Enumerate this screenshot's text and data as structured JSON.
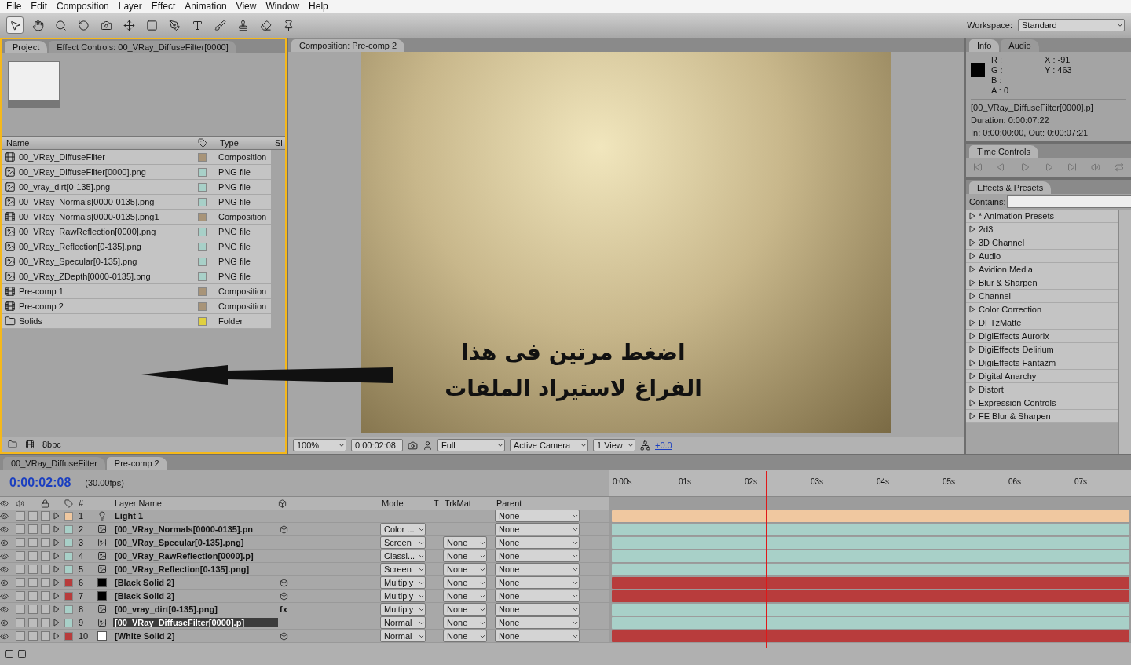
{
  "menu": [
    "File",
    "Edit",
    "Composition",
    "Layer",
    "Effect",
    "Animation",
    "View",
    "Window",
    "Help"
  ],
  "toolbar": {
    "workspace_label": "Workspace:",
    "workspace": "Standard"
  },
  "project": {
    "tabs": [
      {
        "label": "Project",
        "selected": true
      },
      {
        "label": "Effect Controls: 00_VRay_DiffuseFilter[0000]",
        "selected": false
      }
    ],
    "columns": [
      "Name",
      "Type",
      "Si"
    ],
    "items": [
      {
        "name": "00_VRay_DiffuseFilter",
        "type": "Composition",
        "kind": "comp",
        "color": "#a89478"
      },
      {
        "name": "00_VRay_DiffuseFilter[0000].png",
        "type": "PNG file",
        "kind": "png",
        "color": "#a8d0c8"
      },
      {
        "name": "00_vray_dirt[0-135].png",
        "type": "PNG file",
        "kind": "png",
        "color": "#a8d0c8"
      },
      {
        "name": "00_VRay_Normals[0000-0135].png",
        "type": "PNG file",
        "kind": "png",
        "color": "#a8d0c8"
      },
      {
        "name": "00_VRay_Normals[0000-0135].png1",
        "type": "Composition",
        "kind": "comp",
        "color": "#a89478"
      },
      {
        "name": "00_VRay_RawReflection[0000].png",
        "type": "PNG file",
        "kind": "png",
        "color": "#a8d0c8"
      },
      {
        "name": "00_VRay_Reflection[0-135].png",
        "type": "PNG file",
        "kind": "png",
        "color": "#a8d0c8"
      },
      {
        "name": "00_VRay_Specular[0-135].png",
        "type": "PNG file",
        "kind": "png",
        "color": "#a8d0c8"
      },
      {
        "name": "00_VRay_ZDepth[0000-0135].png",
        "type": "PNG file",
        "kind": "png",
        "color": "#a8d0c8"
      },
      {
        "name": "Pre-comp 1",
        "type": "Composition",
        "kind": "comp",
        "color": "#a89478"
      },
      {
        "name": "Pre-comp 2",
        "type": "Composition",
        "kind": "comp",
        "color": "#a89478"
      },
      {
        "name": "Solids",
        "type": "Folder",
        "kind": "folder",
        "color": "#e0d040"
      }
    ],
    "depth": "8bpc"
  },
  "viewer": {
    "tab": "Composition: Pre-comp 2",
    "annotation": [
      "اضغط مرتين فى هذا",
      "الفراغ لاستيراد الملفات"
    ],
    "zoom": "100%",
    "time": "0:00:02:08",
    "resolution": "Full",
    "camera": "Active Camera",
    "views": "1 View",
    "exposure": "+0.0"
  },
  "info": {
    "tabs": [
      {
        "label": "Info",
        "selected": true
      },
      {
        "label": "Audio",
        "selected": false
      }
    ],
    "channels": [
      "R :",
      "G :",
      "B :",
      "A :  0"
    ],
    "coords": [
      "X : -91",
      "Y : 463"
    ],
    "lines": [
      "[00_VRay_DiffuseFilter[0000].p]",
      "Duration: 0:00:07:22",
      "In: 0:00:00:00, Out: 0:00:07:21"
    ]
  },
  "time_controls": {
    "title": "Time Controls"
  },
  "effects": {
    "title": "Effects & Presets",
    "contains": "Contains:",
    "items": [
      "* Animation Presets",
      "2d3",
      "3D Channel",
      "Audio",
      "Avidion Media",
      "Blur & Sharpen",
      "Channel",
      "Color Correction",
      "DFTzMatte",
      "DigiEffects Aurorix",
      "DigiEffects Delirium",
      "DigiEffects Fantazm",
      "Digital Anarchy",
      "Distort",
      "Expression Controls",
      "FE Blur & Sharpen"
    ]
  },
  "timeline": {
    "tabs": [
      {
        "label": "00_VRay_DiffuseFilter",
        "selected": false
      },
      {
        "label": "Pre-comp 2",
        "selected": true
      }
    ],
    "timecode": "0:00:02:08",
    "fx_label": "fx",
    "fps": "(30.00fps)",
    "columns": {
      "number": "#",
      "name": "Layer Name",
      "mode": "Mode",
      "t": "T",
      "trkmat": "TrkMat",
      "parent": "Parent"
    },
    "ticks": [
      "0:00s",
      "01s",
      "02s",
      "03s",
      "04s",
      "05s",
      "06s",
      "07s"
    ],
    "playhead": {
      "level": 0.3
    },
    "layers": [
      {
        "number": "1",
        "name": "Light 1",
        "kind": "light",
        "color": "#f0c8a0",
        "parent": "None",
        "selected": false,
        "three_d": false,
        "fx": false
      },
      {
        "number": "2",
        "name": "[00_VRay_Normals[0000-0135].pn",
        "kind": "footage",
        "color": "#a8d0c8",
        "mode": "Color ...",
        "parent": "None",
        "selected": false,
        "three_d": true,
        "fx": false
      },
      {
        "number": "3",
        "name": "[00_VRay_Specular[0-135].png]",
        "kind": "footage",
        "color": "#a8d0c8",
        "mode": "Screen",
        "trkmat": "None",
        "parent": "None",
        "selected": false,
        "three_d": false,
        "fx": false
      },
      {
        "number": "4",
        "name": "[00_VRay_RawReflection[0000].p]",
        "kind": "footage",
        "color": "#a8d0c8",
        "mode": "Classi...",
        "trkmat": "None",
        "parent": "None",
        "selected": false,
        "three_d": false,
        "fx": false
      },
      {
        "number": "5",
        "name": "[00_VRay_Reflection[0-135].png]",
        "kind": "footage",
        "color": "#a8d0c8",
        "mode": "Screen",
        "trkmat": "None",
        "parent": "None",
        "selected": false,
        "three_d": false,
        "fx": false
      },
      {
        "number": "6",
        "name": "[Black Solid 2]",
        "kind": "solid",
        "thumbnail": {
          "color": "#000000"
        },
        "color": "#b83c3c",
        "mode": "Multiply",
        "trkmat": "None",
        "parent": "None",
        "selected": false,
        "three_d": true,
        "fx": false
      },
      {
        "number": "7",
        "name": "[Black Solid 2]",
        "kind": "solid",
        "thumbnail": {
          "color": "#000000"
        },
        "color": "#b83c3c",
        "mode": "Multiply",
        "trkmat": "None",
        "parent": "None",
        "selected": false,
        "three_d": true,
        "fx": false
      },
      {
        "number": "8",
        "name": "[00_vray_dirt[0-135].png]",
        "kind": "footage",
        "color": "#a8d0c8",
        "mode": "Multiply",
        "trkmat": "None",
        "parent": "None",
        "selected": false,
        "three_d": false,
        "fx": true
      },
      {
        "number": "9",
        "name": "[00_VRay_DiffuseFilter[0000].p]",
        "kind": "footage",
        "color": "#a8d0c8",
        "mode": "Normal",
        "trkmat": "None",
        "parent": "None",
        "selected": true,
        "three_d": false,
        "fx": false
      },
      {
        "number": "10",
        "name": "[White Solid 2]",
        "kind": "solid",
        "thumbnail": {
          "color": "#ffffff"
        },
        "color": "#b83c3c",
        "mode": "Normal",
        "trkmat": "None",
        "parent": "None",
        "selected": false,
        "three_d": true,
        "fx": false
      }
    ]
  }
}
